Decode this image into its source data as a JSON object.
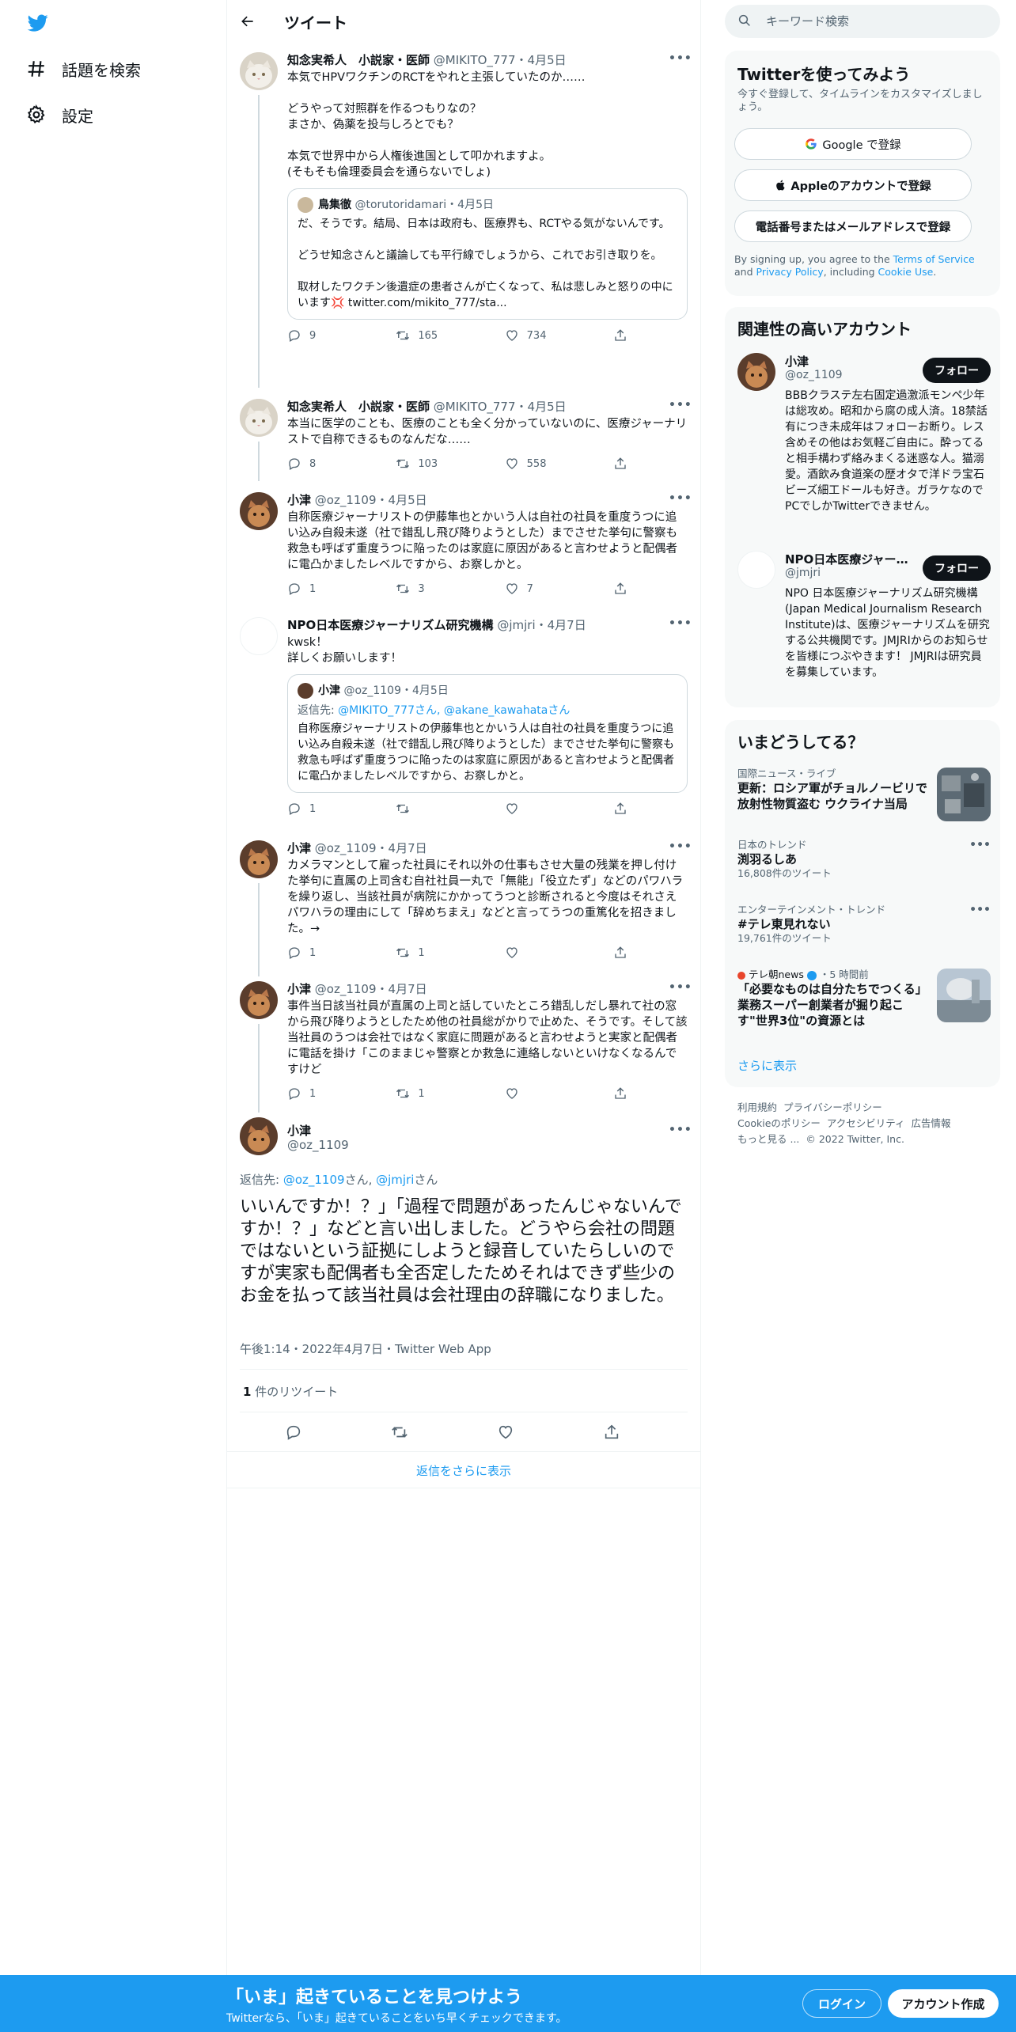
{
  "nav": {
    "explore_label": "話題を検索",
    "settings_label": "設定"
  },
  "header": {
    "title": "ツイート"
  },
  "tweets": [
    {
      "name": "知念実希人　小説家・医師",
      "handle": "@MIKITO_777",
      "date": "4月5日",
      "text": "本気でHPVワクチンのRCTをやれと主張していたのか……\n\nどうやって対照群を作るつもりなの？\nまさか、偽薬を投与しろとでも？\n\n本気で世界中から人権後進国として叩かれますよ。\n(そもそも倫理委員会を通らないでしょ)",
      "quote": {
        "name": "鳥集徹",
        "handle": "@torutoridamari",
        "date": "4月5日",
        "text": "だ、そうです。結局、日本は政府も、医療界も、RCTやる気がないんです。\n\nどうせ知念さんと議論しても平行線でしょうから、これでお引き取りを。\n\n取材したワクチン後遺症の患者さんが亡くなって、私は悲しみと怒りの中にいます💢 twitter.com/mikito_777/sta..."
      },
      "replies": "9",
      "retweets": "165",
      "likes": "734"
    },
    {
      "name": "知念実希人　小説家・医師",
      "handle": "@MIKITO_777",
      "date": "4月5日",
      "text": "本当に医学のことも、医療のことも全く分かっていないのに、医療ジャーナリストで自称できるものなんだな……",
      "replies": "8",
      "retweets": "103",
      "likes": "558"
    },
    {
      "name": "小津",
      "handle": "@oz_1109",
      "date": "4月5日",
      "text": "自称医療ジャーナリストの伊藤隼也とかいう人は自社の社員を重度うつに追い込み自殺未遂（社で錯乱し飛び降りようとした）までさせた挙句に警察も救急も呼ばず重度うつに陥ったのは家庭に原因があると言わせようと配偶者に電凸かましたレベルですから、お察しかと。",
      "replies": "1",
      "retweets": "3",
      "likes": "7"
    },
    {
      "name": "NPO日本医療ジャーナリズム研究機構",
      "handle": "@jmjri",
      "date": "4月7日",
      "text": "kwsk！\n詳しくお願いします！",
      "quote": {
        "name": "小津",
        "handle": "@oz_1109",
        "date": "4月5日",
        "reply_prefix": "返信先: ",
        "reply_targets": "@MIKITO_777さん, @akane_kawahataさん",
        "text": "自称医療ジャーナリストの伊藤隼也とかいう人は自社の社員を重度うつに追い込み自殺未遂（社で錯乱し飛び降りようとした）までさせた挙句に警察も救急も呼ばず重度うつに陥ったのは家庭に原因があると言わせようと配偶者に電凸かましたレベルですから、お察しかと。"
      },
      "replies": "1",
      "retweets": "",
      "likes": ""
    },
    {
      "name": "小津",
      "handle": "@oz_1109",
      "date": "4月7日",
      "text": "カメラマンとして雇った社員にそれ以外の仕事もさせ大量の残業を押し付けた挙句に直属の上司含む自社社員一丸で「無能」「役立たず」などのパワハラを繰り返し、当該社員が病院にかかってうつと診断されると今度はそれさえパワハラの理由にして「辞めちまえ」などと言ってうつの重篤化を招きました。→",
      "replies": "1",
      "retweets": "1",
      "likes": ""
    },
    {
      "name": "小津",
      "handle": "@oz_1109",
      "date": "4月7日",
      "text": "事件当日該当社員が直属の上司と話していたところ錯乱しだし暴れて社の窓から飛び降りようとしたため他の社員総がかりで止めた、そうです。そして該当社員のうつは会社ではなく家庭に問題があると言わせようと実家と配偶者に電話を掛け「このままじゃ警察とか救急に連絡しないといけなくなるんですけど",
      "replies": "1",
      "retweets": "1",
      "likes": ""
    }
  ],
  "focal": {
    "name": "小津",
    "handle": "@oz_1109",
    "reply_prefix": "返信先: ",
    "reply_user1": "@oz_1109",
    "reply_mid": "さん, ",
    "reply_user2": "@jmjri",
    "reply_suffix": "さん",
    "text": "いいんですか！？」「過程で問題があったんじゃないんですか！？」などと言い出しました。どうやら会社の問題ではないという証拠にしようと録音していたらしいのですが実家も配偶者も全否定したためそれはできず些少のお金を払って該当社員は会社理由の辞職になりました。",
    "timestamp": "午後1:14・2022年4月7日・Twitter Web App",
    "retweet_count": "1",
    "retweet_label": " 件のリツイート"
  },
  "show_more_replies": "返信をさらに表示",
  "search": {
    "placeholder": "キーワード検索"
  },
  "signup_card": {
    "title": "Twitterを使ってみよう",
    "subtitle": "今すぐ登録して、タイムラインをカスタマイズしましょう。",
    "google": "Google で登録",
    "apple": "Appleのアカウントで登録",
    "phone": "電話番号またはメールアドレスで登録",
    "legal_1": "By signing up, you agree to the ",
    "legal_terms": "Terms of Service",
    "legal_2": " and ",
    "legal_privacy": "Privacy Policy",
    "legal_3": ", including ",
    "legal_cookie": "Cookie Use",
    "legal_4": "."
  },
  "related": {
    "title": "関連性の高いアカウント",
    "follow_label": "フォロー",
    "accounts": [
      {
        "name": "小津",
        "handle": "@oz_1109",
        "bio": "BBBクラステ左右固定過激派モンペ少年は総攻め。昭和から腐の成人済。18禁話有につき未成年はフォローお断り。レス含めその他はお気軽ご自由に。酔ってると相手構わず絡みまくる迷惑な人。猫溺愛。酒飲み食道楽の歴オタで洋ドラ宝石ビーズ細工ドールも好き。ガラケなのでPCでしかTwitterできません。"
      },
      {
        "name": "NPO日本医療ジャーナリズム研究機構",
        "handle": "@jmjri",
        "bio": "NPO 日本医療ジャーナリズム研究機構(Japan Medical Journalism Research Institute)は、医療ジャーナリズムを研究する公共機関です。JMJRIからのお知らせを皆様につぶやきます！ JMJRIは研究員を募集しています。"
      }
    ]
  },
  "trends": {
    "title": "いまどうしてる？",
    "items": [
      {
        "category": "国際ニュース・ライブ",
        "title": "更新：ロシア軍がチョルノービリで放射性物質盗む ウクライナ当局"
      },
      {
        "category": "日本のトレンド",
        "title": "渕羽るしあ",
        "count": "16,808件のツイート"
      },
      {
        "category": "エンターテインメント・トレンド",
        "title": "#テレ東見れない",
        "count": "19,761件のツイート"
      },
      {
        "source": "テレ朝news",
        "time": "5 時間前",
        "title": "「必要なものは自分たちでつくる」　業務スーパー創業者が掘り起こす\"世界3位\"の資源とは"
      }
    ],
    "show_more": "さらに表示"
  },
  "footer": {
    "terms": "利用規約",
    "privacy": "プライバシーポリシー",
    "cookie": "Cookieのポリシー",
    "accessibility": "アクセシビリティ",
    "ads": "広告情報",
    "more": "もっと見る ...",
    "copyright": "© 2022 Twitter, Inc."
  },
  "bottom_bar": {
    "title": "「いま」起きていることを見つけよう",
    "subtitle": "Twitterなら、「いま」起きていることをいち早くチェックできます。",
    "login": "ログイン",
    "signup": "アカウント作成"
  },
  "colors": {
    "accent": "#1d9bf0",
    "text": "#0f1419",
    "secondary": "#536471"
  }
}
